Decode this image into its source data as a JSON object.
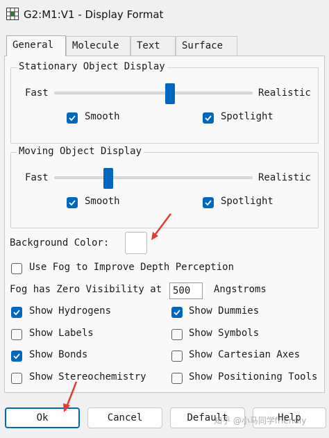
{
  "window": {
    "title": "G2:M1:V1 - Display Format",
    "icon": "app-grid-icon"
  },
  "tabs": [
    {
      "label": "General",
      "active": true
    },
    {
      "label": "Molecule",
      "active": false
    },
    {
      "label": "Text",
      "active": false
    },
    {
      "label": "Surface",
      "active": false
    }
  ],
  "stationary": {
    "legend": "Stationary Object Display",
    "fast_label": "Fast",
    "realistic_label": "Realistic",
    "slider_level": 0.59,
    "smooth": {
      "label": "Smooth",
      "checked": true
    },
    "spotlight": {
      "label": "Spotlight",
      "checked": true
    }
  },
  "moving": {
    "legend": "Moving Object Display",
    "fast_label": "Fast",
    "realistic_label": "Realistic",
    "slider_level": 0.26,
    "smooth": {
      "label": "Smooth",
      "checked": true
    },
    "spotlight": {
      "label": "Spotlight",
      "checked": true
    }
  },
  "background": {
    "label": "Background Color:",
    "color": "#ffffff"
  },
  "fog": {
    "use_label": "Use Fog to Improve Depth Perception",
    "use_checked": false,
    "zero_label": "Fog has Zero Visibility at",
    "value": "500",
    "unit": "Angstroms"
  },
  "options": {
    "hydrogens": {
      "label": "Show Hydrogens",
      "checked": true
    },
    "dummies": {
      "label": "Show Dummies",
      "checked": true
    },
    "labels": {
      "label": "Show Labels",
      "checked": false
    },
    "symbols": {
      "label": "Show Symbols",
      "checked": false
    },
    "bonds": {
      "label": "Show Bonds",
      "checked": true
    },
    "cartesian": {
      "label": "Show Cartesian Axes",
      "checked": false
    },
    "stereo": {
      "label": "Show Stereochemistry",
      "checked": false
    },
    "positioning": {
      "label": "Show Positioning Tools",
      "checked": false
    }
  },
  "buttons": {
    "ok": "Ok",
    "cancel": "Cancel",
    "default": "Default",
    "help": "Help"
  },
  "watermark": "知乎 @小马同学friendly",
  "colors": {
    "accent": "#0067c0",
    "annotation_arrow": "#e53935"
  }
}
